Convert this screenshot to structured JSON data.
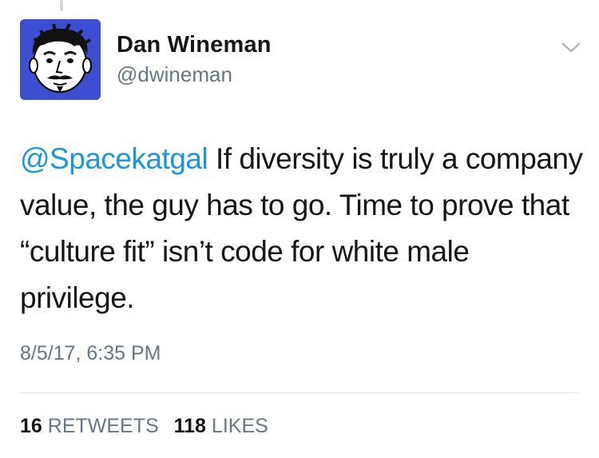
{
  "author": {
    "display_name": "Dan Wineman",
    "handle": "@dwineman",
    "avatar_icon": "cartoon-face-avatar-icon",
    "avatar_bg": "#3b4fd0"
  },
  "tweet": {
    "mention": "@Spacekatgal",
    "text": " If diversity is truly a company value, the guy has to go. Time to prove that “culture fit” isn’t code for white male privilege.",
    "timestamp": "8/5/17, 6:35 PM"
  },
  "stats": {
    "retweets_count": "16",
    "retweets_label": "RETWEETS",
    "likes_count": "118",
    "likes_label": "LIKES"
  },
  "colors": {
    "link": "#1b95e0",
    "text": "#14171a",
    "muted": "#657786"
  },
  "icons": {
    "menu": "chevron-down-icon"
  }
}
